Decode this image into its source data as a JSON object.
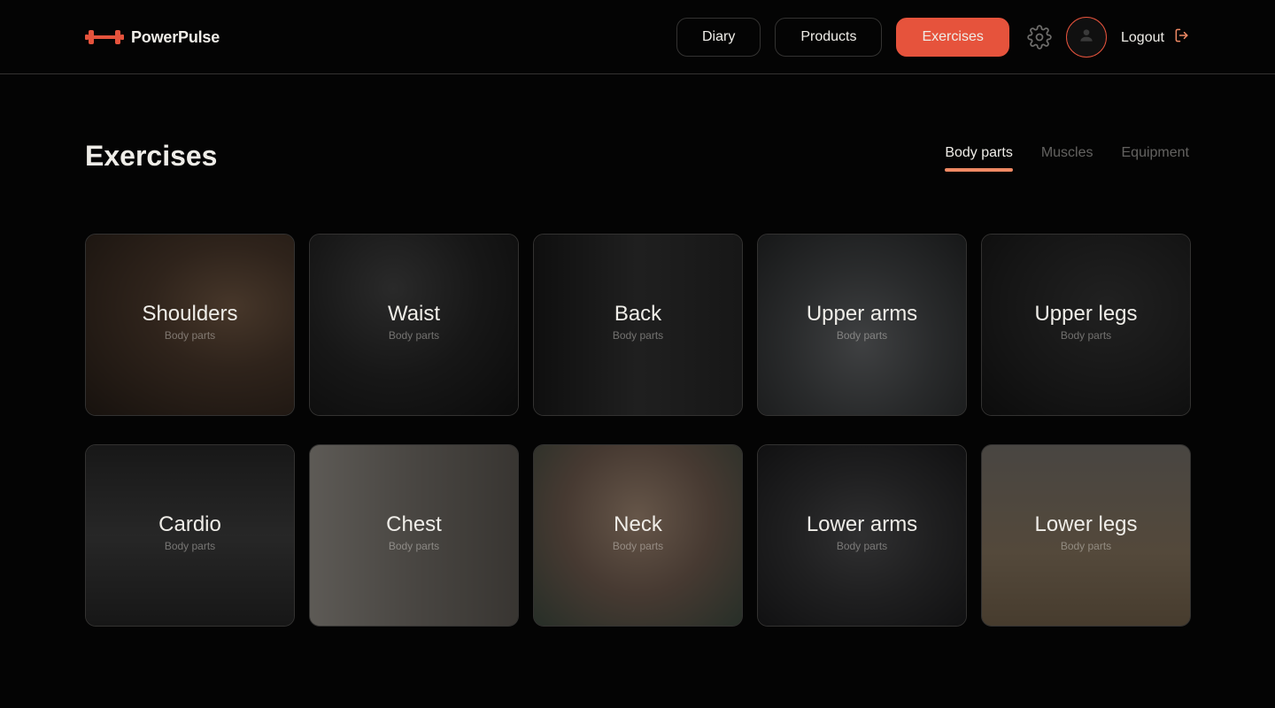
{
  "brand": {
    "name": "PowerPulse",
    "accent": "#e6533c"
  },
  "nav": {
    "items": [
      {
        "label": "Diary",
        "active": false
      },
      {
        "label": "Products",
        "active": false
      },
      {
        "label": "Exercises",
        "active": true
      }
    ],
    "settings_icon": "gear-icon",
    "avatar_icon": "user-icon",
    "logout_label": "Logout",
    "logout_icon": "logout-icon"
  },
  "page": {
    "title": "Exercises"
  },
  "filters": [
    {
      "label": "Body parts",
      "active": true
    },
    {
      "label": "Muscles",
      "active": false
    },
    {
      "label": "Equipment",
      "active": false
    }
  ],
  "cards": [
    {
      "title": "Shoulders",
      "subtitle": "Body parts"
    },
    {
      "title": "Waist",
      "subtitle": "Body parts"
    },
    {
      "title": "Back",
      "subtitle": "Body parts"
    },
    {
      "title": "Upper arms",
      "subtitle": "Body parts"
    },
    {
      "title": "Upper legs",
      "subtitle": "Body parts"
    },
    {
      "title": "Cardio",
      "subtitle": "Body parts"
    },
    {
      "title": "Chest",
      "subtitle": "Body parts"
    },
    {
      "title": "Neck",
      "subtitle": "Body parts"
    },
    {
      "title": "Lower arms",
      "subtitle": "Body parts"
    },
    {
      "title": "Lower legs",
      "subtitle": "Body parts"
    }
  ]
}
